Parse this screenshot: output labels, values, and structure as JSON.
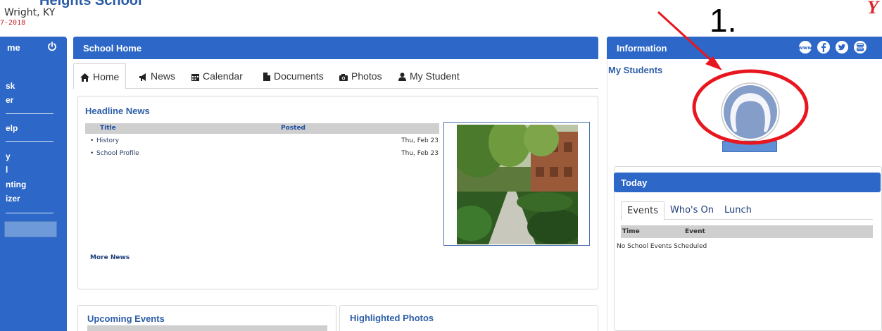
{
  "header": {
    "school_name": "Heights School",
    "location": "Wright, KY",
    "year": "7-2018",
    "corner_logo": "Y"
  },
  "left_menu": {
    "title": "me",
    "power_icon": "power-icon",
    "items": [
      "sk",
      "er",
      "elp",
      "y",
      "l",
      "nting",
      "izer"
    ]
  },
  "center": {
    "title": "School Home",
    "tabs": [
      {
        "label": "Home",
        "icon": "home-icon"
      },
      {
        "label": "News",
        "icon": "megaphone-icon"
      },
      {
        "label": "Calendar",
        "icon": "calendar-icon"
      },
      {
        "label": "Documents",
        "icon": "document-icon"
      },
      {
        "label": "Photos",
        "icon": "camera-icon"
      },
      {
        "label": "My Student",
        "icon": "user-icon"
      }
    ],
    "headline": {
      "title": "Headline News",
      "col_title": "Title",
      "col_posted": "Posted",
      "rows": [
        {
          "bullet": "•",
          "title": "History",
          "date": "Thu, Feb 23"
        },
        {
          "bullet": "•",
          "title": "School Profile",
          "date": "Thu, Feb 23"
        }
      ],
      "more": "More News"
    },
    "upcoming_title": "Upcoming Events",
    "photos_title": "Highlighted Photos"
  },
  "right": {
    "title": "Information",
    "social_icons": [
      "web-icon",
      "facebook-icon",
      "twitter-icon",
      "youtube-icon"
    ],
    "my_students": "My Students",
    "annotation_number": "1."
  },
  "today": {
    "title": "Today",
    "tabs": [
      "Events",
      "Who's On",
      "Lunch"
    ],
    "col_time": "Time",
    "col_event": "Event",
    "empty": "No School Events Scheduled"
  },
  "colors": {
    "brand_blue": "#2d67c8",
    "link_blue": "#2d5ea8",
    "annotation_red": "#e8161e"
  }
}
